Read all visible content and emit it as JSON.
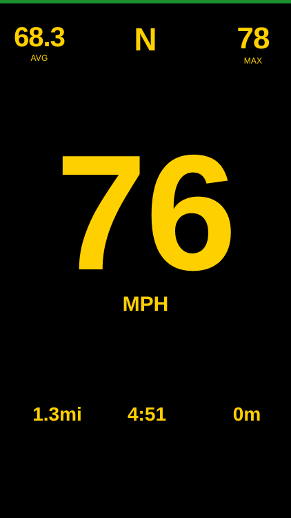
{
  "colors": {
    "background": "#000000",
    "text": "#FFD000",
    "top_accent": "#1E8F2E"
  },
  "stats": {
    "avg_value": "68.3",
    "avg_label": "AVG",
    "heading": "N",
    "max_value": "78",
    "max_label": "MAX"
  },
  "speedometer": {
    "speed": "76",
    "unit": "MPH"
  },
  "trip": {
    "distance": "1.3mi",
    "time": "4:51",
    "altitude": "0m"
  }
}
